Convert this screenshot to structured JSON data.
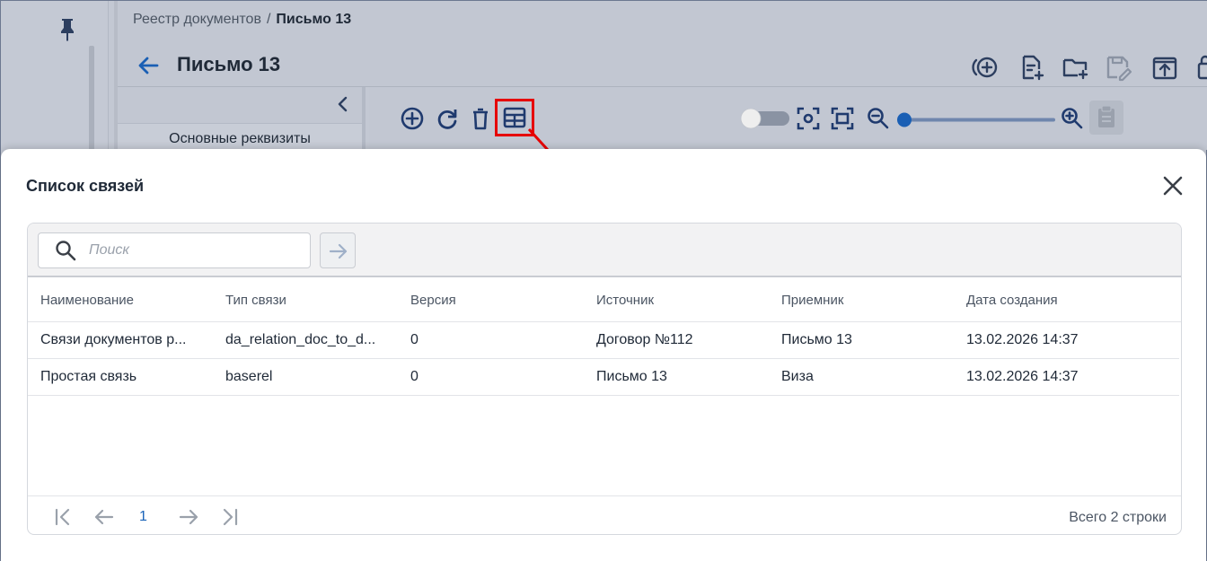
{
  "breadcrumb": {
    "root": "Реестр документов",
    "separator": "/",
    "current": "Письмо 13"
  },
  "document": {
    "title": "Письмо 13"
  },
  "side_panel": {
    "tab_label": "Основные реквизиты"
  },
  "header_actions": [
    "add-circle-icon",
    "new-document-icon",
    "new-folder-icon",
    "edit-save-icon",
    "upload-icon",
    "lock-icon"
  ],
  "viewer_toolbar": {
    "tools": [
      "add-icon",
      "refresh-icon",
      "delete-icon",
      "table-icon"
    ],
    "toggle_enabled": false,
    "zoom_level": 0.0
  },
  "modal": {
    "title": "Список связей",
    "search": {
      "placeholder": "Поиск",
      "value": ""
    },
    "columns": [
      "Наименование",
      "Тип связи",
      "Версия",
      "Источник",
      "Приемник",
      "Дата создания"
    ],
    "rows": [
      [
        "Связи документов р...",
        "da_relation_doc_to_d...",
        "0",
        "Договор №112",
        "Письмо 13",
        "13.02.2026 14:37"
      ],
      [
        "Простая связь",
        "baserel",
        "0",
        "Письмо 13",
        "Виза",
        "13.02.2026 14:37"
      ]
    ],
    "pagination": {
      "current_page": "1",
      "total_label": "Всего 2 строки"
    }
  },
  "colors": {
    "accent": "#1a63b8",
    "dark_icon": "#1f3a6e",
    "highlight": "#e60000",
    "overlay": "#c3c8d3"
  }
}
